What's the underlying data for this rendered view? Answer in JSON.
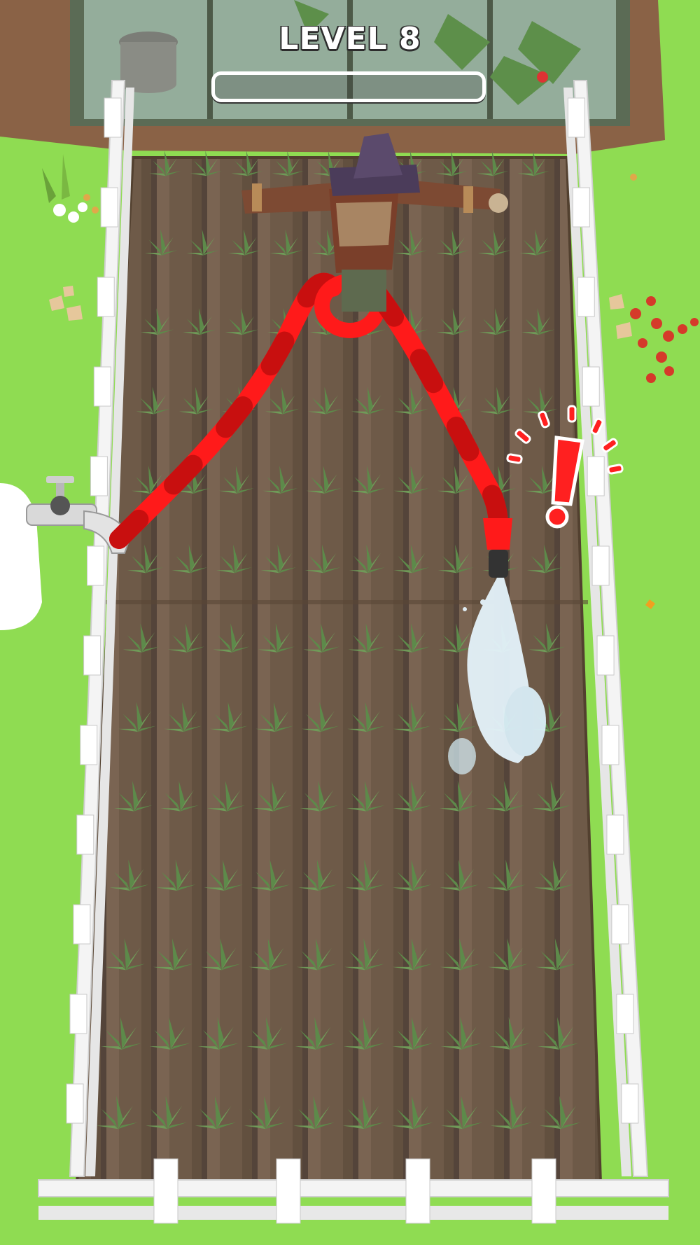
{
  "hud": {
    "level_label": "LEVEL 8",
    "level_progress": 0
  },
  "colors": {
    "grass": "#8fdc52",
    "soil": "#6e5a48",
    "hose": "#ff1a1a",
    "water": "#e4f3fb",
    "fence": "#f4f4f4",
    "alert": "#ff2020"
  },
  "scene": {
    "objects": [
      "greenhouse",
      "scarecrow",
      "garden-hose",
      "water-faucet",
      "water-spray",
      "alert-exclamation-icon",
      "crop-field",
      "white-fence",
      "red-flowers",
      "white-flowers",
      "rocks",
      "wooden-bucket"
    ]
  }
}
